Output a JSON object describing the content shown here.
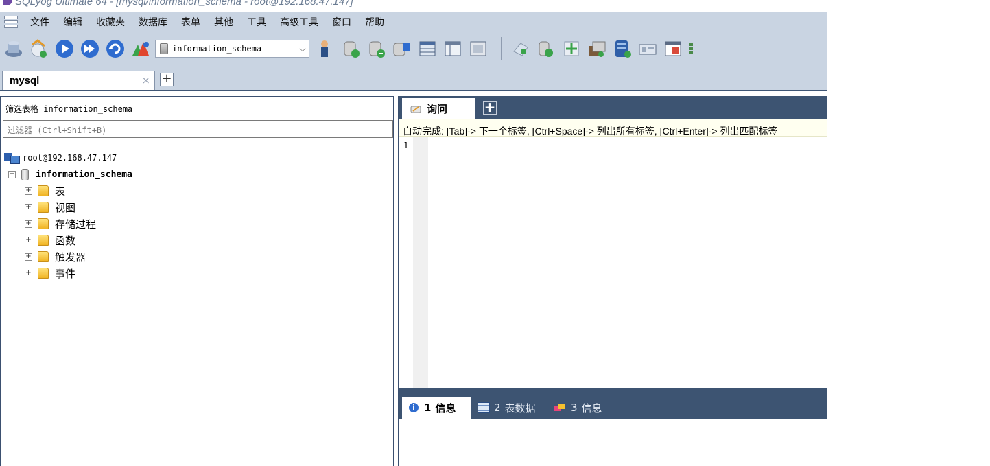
{
  "window": {
    "title": "SQLyog Ultimate 64 - [mysql/information_schema - root@192.168.47.147]"
  },
  "menu": [
    "文件",
    "编辑",
    "收藏夹",
    "数据库",
    "表单",
    "其他",
    "工具",
    "高级工具",
    "窗口",
    "帮助"
  ],
  "toolbar": {
    "database_selector": "information_schema",
    "icons_before": [
      "connect-icon",
      "new-connection-icon",
      "execute-query-icon",
      "execute-all-icon",
      "refresh-icon",
      "stop-icon"
    ],
    "icons_after": [
      "user-manager-icon",
      "create-database-icon",
      "create-table-icon",
      "backup-icon",
      "table-data-icon",
      "table-info-icon",
      "history-icon"
    ],
    "icons_tail": [
      "schema-sync-icon",
      "data-sync-icon",
      "import-icon",
      "export-icon",
      "database-copy-icon",
      "schema-designer-icon",
      "query-builder-icon",
      "more-icon"
    ]
  },
  "connection_tab": {
    "label": "mysql",
    "close": "×",
    "add": "+"
  },
  "object_browser": {
    "filter_label": "筛选表格 information_schema",
    "filter_placeholder": "过滤器 (Ctrl+Shift+B)",
    "server": "root@192.168.47.147",
    "database": "information_schema",
    "nodes": [
      "表",
      "视图",
      "存储过程",
      "函数",
      "触发器",
      "事件"
    ]
  },
  "query_panel": {
    "tab_label": "询问",
    "add": "+",
    "autocomplete_hint": "自动完成: [Tab]-> 下一个标签, [Ctrl+Space]-> 列出所有标签, [Ctrl+Enter]-> 列出匹配标签",
    "line_number": "1"
  },
  "result_tabs": [
    {
      "number": "1",
      "label": "信息"
    },
    {
      "number": "2",
      "label": "表数据"
    },
    {
      "number": "3",
      "label": "信息"
    }
  ],
  "colors": {
    "chrome": "#c9d4e2",
    "dark_panel": "#3d5472",
    "autocomplete_bg": "#fffff0"
  }
}
